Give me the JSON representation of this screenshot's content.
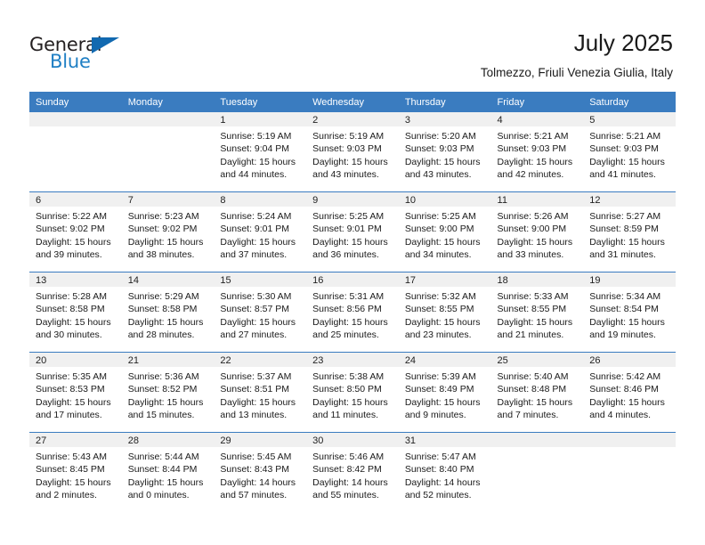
{
  "brand": {
    "name_dark": "General",
    "name_blue": "Blue",
    "accent_blue": "#1169b0",
    "header_blue": "#3a7cc0"
  },
  "header": {
    "title": "July 2025",
    "subtitle": "Tolmezzo, Friuli Venezia Giulia, Italy"
  },
  "weekday_headers": [
    "Sunday",
    "Monday",
    "Tuesday",
    "Wednesday",
    "Thursday",
    "Friday",
    "Saturday"
  ],
  "weeks": [
    [
      {
        "day": "",
        "empty": true
      },
      {
        "day": "",
        "empty": true
      },
      {
        "day": "1",
        "sunrise": "Sunrise: 5:19 AM",
        "sunset": "Sunset: 9:04 PM",
        "daylight": "Daylight: 15 hours and 44 minutes."
      },
      {
        "day": "2",
        "sunrise": "Sunrise: 5:19 AM",
        "sunset": "Sunset: 9:03 PM",
        "daylight": "Daylight: 15 hours and 43 minutes."
      },
      {
        "day": "3",
        "sunrise": "Sunrise: 5:20 AM",
        "sunset": "Sunset: 9:03 PM",
        "daylight": "Daylight: 15 hours and 43 minutes."
      },
      {
        "day": "4",
        "sunrise": "Sunrise: 5:21 AM",
        "sunset": "Sunset: 9:03 PM",
        "daylight": "Daylight: 15 hours and 42 minutes."
      },
      {
        "day": "5",
        "sunrise": "Sunrise: 5:21 AM",
        "sunset": "Sunset: 9:03 PM",
        "daylight": "Daylight: 15 hours and 41 minutes."
      }
    ],
    [
      {
        "day": "6",
        "sunrise": "Sunrise: 5:22 AM",
        "sunset": "Sunset: 9:02 PM",
        "daylight": "Daylight: 15 hours and 39 minutes."
      },
      {
        "day": "7",
        "sunrise": "Sunrise: 5:23 AM",
        "sunset": "Sunset: 9:02 PM",
        "daylight": "Daylight: 15 hours and 38 minutes."
      },
      {
        "day": "8",
        "sunrise": "Sunrise: 5:24 AM",
        "sunset": "Sunset: 9:01 PM",
        "daylight": "Daylight: 15 hours and 37 minutes."
      },
      {
        "day": "9",
        "sunrise": "Sunrise: 5:25 AM",
        "sunset": "Sunset: 9:01 PM",
        "daylight": "Daylight: 15 hours and 36 minutes."
      },
      {
        "day": "10",
        "sunrise": "Sunrise: 5:25 AM",
        "sunset": "Sunset: 9:00 PM",
        "daylight": "Daylight: 15 hours and 34 minutes."
      },
      {
        "day": "11",
        "sunrise": "Sunrise: 5:26 AM",
        "sunset": "Sunset: 9:00 PM",
        "daylight": "Daylight: 15 hours and 33 minutes."
      },
      {
        "day": "12",
        "sunrise": "Sunrise: 5:27 AM",
        "sunset": "Sunset: 8:59 PM",
        "daylight": "Daylight: 15 hours and 31 minutes."
      }
    ],
    [
      {
        "day": "13",
        "sunrise": "Sunrise: 5:28 AM",
        "sunset": "Sunset: 8:58 PM",
        "daylight": "Daylight: 15 hours and 30 minutes."
      },
      {
        "day": "14",
        "sunrise": "Sunrise: 5:29 AM",
        "sunset": "Sunset: 8:58 PM",
        "daylight": "Daylight: 15 hours and 28 minutes."
      },
      {
        "day": "15",
        "sunrise": "Sunrise: 5:30 AM",
        "sunset": "Sunset: 8:57 PM",
        "daylight": "Daylight: 15 hours and 27 minutes."
      },
      {
        "day": "16",
        "sunrise": "Sunrise: 5:31 AM",
        "sunset": "Sunset: 8:56 PM",
        "daylight": "Daylight: 15 hours and 25 minutes."
      },
      {
        "day": "17",
        "sunrise": "Sunrise: 5:32 AM",
        "sunset": "Sunset: 8:55 PM",
        "daylight": "Daylight: 15 hours and 23 minutes."
      },
      {
        "day": "18",
        "sunrise": "Sunrise: 5:33 AM",
        "sunset": "Sunset: 8:55 PM",
        "daylight": "Daylight: 15 hours and 21 minutes."
      },
      {
        "day": "19",
        "sunrise": "Sunrise: 5:34 AM",
        "sunset": "Sunset: 8:54 PM",
        "daylight": "Daylight: 15 hours and 19 minutes."
      }
    ],
    [
      {
        "day": "20",
        "sunrise": "Sunrise: 5:35 AM",
        "sunset": "Sunset: 8:53 PM",
        "daylight": "Daylight: 15 hours and 17 minutes."
      },
      {
        "day": "21",
        "sunrise": "Sunrise: 5:36 AM",
        "sunset": "Sunset: 8:52 PM",
        "daylight": "Daylight: 15 hours and 15 minutes."
      },
      {
        "day": "22",
        "sunrise": "Sunrise: 5:37 AM",
        "sunset": "Sunset: 8:51 PM",
        "daylight": "Daylight: 15 hours and 13 minutes."
      },
      {
        "day": "23",
        "sunrise": "Sunrise: 5:38 AM",
        "sunset": "Sunset: 8:50 PM",
        "daylight": "Daylight: 15 hours and 11 minutes."
      },
      {
        "day": "24",
        "sunrise": "Sunrise: 5:39 AM",
        "sunset": "Sunset: 8:49 PM",
        "daylight": "Daylight: 15 hours and 9 minutes."
      },
      {
        "day": "25",
        "sunrise": "Sunrise: 5:40 AM",
        "sunset": "Sunset: 8:48 PM",
        "daylight": "Daylight: 15 hours and 7 minutes."
      },
      {
        "day": "26",
        "sunrise": "Sunrise: 5:42 AM",
        "sunset": "Sunset: 8:46 PM",
        "daylight": "Daylight: 15 hours and 4 minutes."
      }
    ],
    [
      {
        "day": "27",
        "sunrise": "Sunrise: 5:43 AM",
        "sunset": "Sunset: 8:45 PM",
        "daylight": "Daylight: 15 hours and 2 minutes."
      },
      {
        "day": "28",
        "sunrise": "Sunrise: 5:44 AM",
        "sunset": "Sunset: 8:44 PM",
        "daylight": "Daylight: 15 hours and 0 minutes."
      },
      {
        "day": "29",
        "sunrise": "Sunrise: 5:45 AM",
        "sunset": "Sunset: 8:43 PM",
        "daylight": "Daylight: 14 hours and 57 minutes."
      },
      {
        "day": "30",
        "sunrise": "Sunrise: 5:46 AM",
        "sunset": "Sunset: 8:42 PM",
        "daylight": "Daylight: 14 hours and 55 minutes."
      },
      {
        "day": "31",
        "sunrise": "Sunrise: 5:47 AM",
        "sunset": "Sunset: 8:40 PM",
        "daylight": "Daylight: 14 hours and 52 minutes."
      },
      {
        "day": "",
        "empty": true
      },
      {
        "day": "",
        "empty": true
      }
    ]
  ]
}
